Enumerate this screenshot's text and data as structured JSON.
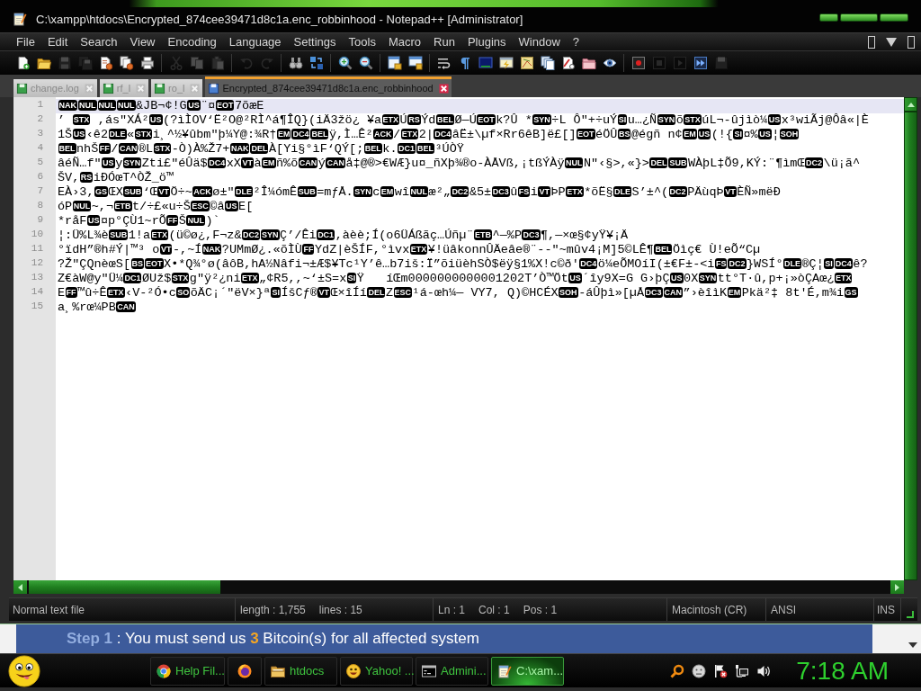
{
  "window": {
    "title": "C:\\xampp\\htdocs\\Encrypted_874cee39471d8c1a.enc_robbinhood - Notepad++ [Administrator]"
  },
  "menu": {
    "items": [
      "File",
      "Edit",
      "Search",
      "View",
      "Encoding",
      "Language",
      "Settings",
      "Tools",
      "Macro",
      "Run",
      "Plugins",
      "Window",
      "?"
    ]
  },
  "toolbar": {
    "groups": [
      {
        "items": [
          {
            "kind": "new",
            "disabled": false
          },
          {
            "kind": "open",
            "disabled": false
          },
          {
            "kind": "save",
            "disabled": true
          },
          {
            "kind": "saveall",
            "disabled": true
          },
          {
            "kind": "close",
            "disabled": false
          },
          {
            "kind": "closeall",
            "disabled": false
          },
          {
            "kind": "print",
            "disabled": false
          }
        ]
      },
      {
        "items": [
          {
            "kind": "cut",
            "disabled": true
          },
          {
            "kind": "copy",
            "disabled": true
          },
          {
            "kind": "paste",
            "disabled": true
          }
        ]
      },
      {
        "items": [
          {
            "kind": "undo",
            "disabled": true
          },
          {
            "kind": "redo",
            "disabled": true
          }
        ]
      },
      {
        "items": [
          {
            "kind": "find",
            "disabled": false
          },
          {
            "kind": "replace",
            "disabled": false
          }
        ]
      },
      {
        "items": [
          {
            "kind": "zoomin",
            "disabled": false
          },
          {
            "kind": "zoomout",
            "disabled": false
          }
        ]
      },
      {
        "items": [
          {
            "kind": "syncv",
            "disabled": false
          },
          {
            "kind": "synch",
            "disabled": false
          }
        ]
      },
      {
        "items": [
          {
            "kind": "wrap",
            "disabled": false
          },
          {
            "kind": "allchars",
            "disabled": false
          },
          {
            "kind": "indent",
            "disabled": false
          },
          {
            "kind": "udl",
            "disabled": false
          },
          {
            "kind": "docmap",
            "disabled": false
          },
          {
            "kind": "funclist",
            "disabled": false
          },
          {
            "kind": "autocomplete",
            "disabled": false
          },
          {
            "kind": "workspace",
            "disabled": false
          },
          {
            "kind": "monitor",
            "disabled": false
          }
        ]
      },
      {
        "items": [
          {
            "kind": "record",
            "disabled": false
          },
          {
            "kind": "stop",
            "disabled": true
          },
          {
            "kind": "play",
            "disabled": true
          },
          {
            "kind": "playmulti",
            "disabled": false
          },
          {
            "kind": "savemacro",
            "disabled": true
          }
        ]
      }
    ]
  },
  "tabs": [
    {
      "label": "change.log",
      "selected": false
    },
    {
      "label": "rf_l",
      "selected": false
    },
    {
      "label": "ro_l",
      "selected": false
    },
    {
      "label": "Encrypted_874cee39471d8c1a.enc_robbinhood",
      "selected": true
    }
  ],
  "editor": {
    "lines": [
      {
        "number": "1",
        "current": true,
        "segments": [
          {
            "kind": "ctrl",
            "text": "NAK"
          },
          {
            "kind": "ctrl",
            "text": "NUL"
          },
          {
            "kind": "ctrl",
            "text": "NUL"
          },
          {
            "kind": "ctrl",
            "text": "NUL"
          },
          {
            "kind": "text",
            "text": "&JB¬¢!G"
          },
          {
            "kind": "ctrl",
            "text": "US"
          },
          {
            "kind": "text",
            "text": "¨¤"
          },
          {
            "kind": "ctrl",
            "text": "EOT"
          },
          {
            "kind": "text",
            "text": "7õæE"
          }
        ]
      },
      {
        "number": "2",
        "current": false,
        "segments": [
          {
            "kind": "text",
            "text": "’ "
          },
          {
            "kind": "ctrl",
            "text": "STX"
          },
          {
            "kind": "text",
            "text": " ,ás\"XÁ²"
          },
          {
            "kind": "ctrl",
            "text": "US"
          },
          {
            "kind": "text",
            "text": "(?ìÌOV‘Ë²O@²RÌ^á¶ÎQ}(iÄ3žö¿ ¥a"
          },
          {
            "kind": "ctrl",
            "text": "ETX"
          },
          {
            "kind": "text",
            "text": "Ú"
          },
          {
            "kind": "ctrl",
            "text": "RS"
          },
          {
            "kind": "text",
            "text": "Ýd"
          },
          {
            "kind": "ctrl",
            "text": "BEL"
          },
          {
            "kind": "text",
            "text": "Ø—Ú"
          },
          {
            "kind": "ctrl",
            "text": "EOT"
          },
          {
            "kind": "text",
            "text": "k?Û *"
          },
          {
            "kind": "ctrl",
            "text": "SYN"
          },
          {
            "kind": "text",
            "text": "÷L Ô\"+÷uÝ"
          },
          {
            "kind": "ctrl",
            "text": "SI"
          },
          {
            "kind": "text",
            "text": "u…¿Ñ"
          },
          {
            "kind": "ctrl",
            "text": "SYN"
          },
          {
            "kind": "text",
            "text": "õ"
          },
          {
            "kind": "ctrl",
            "text": "STX"
          },
          {
            "kind": "text",
            "text": "úL¬-ûjìò¼"
          },
          {
            "kind": "ctrl",
            "text": "US"
          },
          {
            "kind": "text",
            "text": "x³wiÃj@Ôâ«|È"
          }
        ]
      },
      {
        "number": "3",
        "current": false,
        "segments": [
          {
            "kind": "text",
            "text": "1Š"
          },
          {
            "kind": "ctrl",
            "text": "US"
          },
          {
            "kind": "text",
            "text": "‹ê2"
          },
          {
            "kind": "ctrl",
            "text": "DLE"
          },
          {
            "kind": "text",
            "text": "«"
          },
          {
            "kind": "ctrl",
            "text": "STX"
          },
          {
            "kind": "text",
            "text": "i¸^½¥ûbm\"þ¼Y@:¾R†"
          },
          {
            "kind": "ctrl",
            "text": "EM"
          },
          {
            "kind": "ctrl",
            "text": "DC4"
          },
          {
            "kind": "ctrl",
            "text": "BEL"
          },
          {
            "kind": "text",
            "text": "ÿ,Ì…Ê²"
          },
          {
            "kind": "ctrl",
            "text": "ACK"
          },
          {
            "kind": "text",
            "text": "/"
          },
          {
            "kind": "ctrl",
            "text": "ETX"
          },
          {
            "kind": "text",
            "text": "2|"
          },
          {
            "kind": "ctrl",
            "text": "DC4"
          },
          {
            "kind": "text",
            "text": "âË±\\µf×Rr6êB]ë£[]"
          },
          {
            "kind": "ctrl",
            "text": "EOT"
          },
          {
            "kind": "text",
            "text": "éÖÛ"
          },
          {
            "kind": "ctrl",
            "text": "BS"
          },
          {
            "kind": "text",
            "text": "@égñ n¢"
          },
          {
            "kind": "ctrl",
            "text": "EM"
          },
          {
            "kind": "ctrl",
            "text": "US"
          },
          {
            "kind": "text",
            "text": "(!{"
          },
          {
            "kind": "ctrl",
            "text": "SI"
          },
          {
            "kind": "text",
            "text": "¤%"
          },
          {
            "kind": "ctrl",
            "text": "US"
          },
          {
            "kind": "text",
            "text": "¦"
          },
          {
            "kind": "ctrl",
            "text": "SOH"
          }
        ]
      },
      {
        "number": "4",
        "current": false,
        "segments": [
          {
            "kind": "ctrl",
            "text": "BEL"
          },
          {
            "kind": "text",
            "text": "nhŠ"
          },
          {
            "kind": "ctrl",
            "text": "FF"
          },
          {
            "kind": "text",
            "text": "/"
          },
          {
            "kind": "ctrl",
            "text": "CAN"
          },
          {
            "kind": "text",
            "text": "®L"
          },
          {
            "kind": "ctrl",
            "text": "STX"
          },
          {
            "kind": "text",
            "text": "-Ò)À%Ž7+"
          },
          {
            "kind": "ctrl",
            "text": "NAK"
          },
          {
            "kind": "ctrl",
            "text": "DEL"
          },
          {
            "kind": "text",
            "text": "À[Yi§°ìF‘QÝ[;"
          },
          {
            "kind": "ctrl",
            "text": "BEL"
          },
          {
            "kind": "text",
            "text": "k."
          },
          {
            "kind": "ctrl",
            "text": "DC1"
          },
          {
            "kind": "ctrl",
            "text": "BEL"
          },
          {
            "kind": "text",
            "text": "³ÚÒŸ"
          }
        ]
      },
      {
        "number": "5",
        "current": false,
        "segments": [
          {
            "kind": "text",
            "text": "âéÑ…f\""
          },
          {
            "kind": "ctrl",
            "text": "US"
          },
          {
            "kind": "text",
            "text": "y"
          },
          {
            "kind": "ctrl",
            "text": "SYN"
          },
          {
            "kind": "text",
            "text": "Zti£\"éÛä$"
          },
          {
            "kind": "ctrl",
            "text": "DC4"
          },
          {
            "kind": "text",
            "text": "xX"
          },
          {
            "kind": "ctrl",
            "text": "VT"
          },
          {
            "kind": "text",
            "text": "à"
          },
          {
            "kind": "ctrl",
            "text": "EM"
          },
          {
            "kind": "text",
            "text": "ñ%õ"
          },
          {
            "kind": "ctrl",
            "text": "CAN"
          },
          {
            "kind": "text",
            "text": "ý"
          },
          {
            "kind": "ctrl",
            "text": "CAN"
          },
          {
            "kind": "text",
            "text": "å‡@®>€WÆ}u¤_ñXþ¾®o-ÀÅVß,¡tßÝÀÿ"
          },
          {
            "kind": "ctrl",
            "text": "NUL"
          },
          {
            "kind": "text",
            "text": "N\"‹§>,«}>"
          },
          {
            "kind": "ctrl",
            "text": "DEL"
          },
          {
            "kind": "ctrl",
            "text": "SUB"
          },
          {
            "kind": "text",
            "text": "WÀþL‡Õ9,KÝ:¨¶ìmŒ"
          },
          {
            "kind": "ctrl",
            "text": "DC2"
          },
          {
            "kind": "text",
            "text": "\\ü¡ã^"
          }
        ]
      },
      {
        "number": "6",
        "current": false,
        "segments": [
          {
            "kind": "text",
            "text": "ŠV,"
          },
          {
            "kind": "ctrl",
            "text": "RS"
          },
          {
            "kind": "text",
            "text": "iÐÓœT^ÒŽ_ö™"
          }
        ]
      },
      {
        "number": "7",
        "current": false,
        "segments": [
          {
            "kind": "text",
            "text": "EÀ›3,"
          },
          {
            "kind": "ctrl",
            "text": "GS"
          },
          {
            "kind": "text",
            "text": "ŒX"
          },
          {
            "kind": "ctrl",
            "text": "SUB"
          },
          {
            "kind": "text",
            "text": "‘Œ"
          },
          {
            "kind": "ctrl",
            "text": "VT"
          },
          {
            "kind": "text",
            "text": "Ö÷~"
          },
          {
            "kind": "ctrl",
            "text": "ACK"
          },
          {
            "kind": "text",
            "text": "ø±\""
          },
          {
            "kind": "ctrl",
            "text": "DLE"
          },
          {
            "kind": "text",
            "text": "²Î¼ómÊ"
          },
          {
            "kind": "ctrl",
            "text": "SUB"
          },
          {
            "kind": "text",
            "text": "=mƒÅ."
          },
          {
            "kind": "ctrl",
            "text": "SYN"
          },
          {
            "kind": "text",
            "text": "c"
          },
          {
            "kind": "ctrl",
            "text": "EM"
          },
          {
            "kind": "text",
            "text": "wî"
          },
          {
            "kind": "ctrl",
            "text": "NUL"
          },
          {
            "kind": "text",
            "text": "æ²„"
          },
          {
            "kind": "ctrl",
            "text": "DC2"
          },
          {
            "kind": "text",
            "text": "&5±"
          },
          {
            "kind": "ctrl",
            "text": "DC3"
          },
          {
            "kind": "text",
            "text": "û"
          },
          {
            "kind": "ctrl",
            "text": "FS"
          },
          {
            "kind": "text",
            "text": "i"
          },
          {
            "kind": "ctrl",
            "text": "VT"
          },
          {
            "kind": "text",
            "text": "ÞP"
          },
          {
            "kind": "ctrl",
            "text": "ETX"
          },
          {
            "kind": "text",
            "text": "*õË§"
          },
          {
            "kind": "ctrl",
            "text": "DLE"
          },
          {
            "kind": "text",
            "text": "S’±^("
          },
          {
            "kind": "ctrl",
            "text": "DC2"
          },
          {
            "kind": "text",
            "text": "PÄùqÞ"
          },
          {
            "kind": "ctrl",
            "text": "VT"
          },
          {
            "kind": "text",
            "text": "ÈÑ»mëÐ"
          }
        ]
      },
      {
        "number": "8",
        "current": false,
        "segments": [
          {
            "kind": "text",
            "text": "óP"
          },
          {
            "kind": "ctrl",
            "text": "NUL"
          },
          {
            "kind": "text",
            "text": "~,¬"
          },
          {
            "kind": "ctrl",
            "text": "ETB"
          },
          {
            "kind": "text",
            "text": "t/÷£«u÷Š"
          },
          {
            "kind": "ctrl",
            "text": "ESC"
          },
          {
            "kind": "text",
            "text": "©â"
          },
          {
            "kind": "ctrl",
            "text": "US"
          },
          {
            "kind": "text",
            "text": "E["
          }
        ]
      },
      {
        "number": "9",
        "current": false,
        "segments": [
          {
            "kind": "text",
            "text": "*råF"
          },
          {
            "kind": "ctrl",
            "text": "US"
          },
          {
            "kind": "text",
            "text": "¤p°ÇÙ1~rÕ"
          },
          {
            "kind": "ctrl",
            "text": "FF"
          },
          {
            "kind": "text",
            "text": "Š"
          },
          {
            "kind": "ctrl",
            "text": "NUL"
          },
          {
            "kind": "text",
            "text": ")`"
          }
        ]
      },
      {
        "number": "10",
        "current": false,
        "segments": [
          {
            "kind": "text",
            "text": "¦:Ü%L¾è"
          },
          {
            "kind": "ctrl",
            "text": "SUB"
          },
          {
            "kind": "text",
            "text": "1!a"
          },
          {
            "kind": "ctrl",
            "text": "ETX"
          },
          {
            "kind": "text",
            "text": "(ü©ø¿,F¬z&"
          },
          {
            "kind": "ctrl",
            "text": "DC2"
          },
          {
            "kind": "ctrl",
            "text": "SYN"
          },
          {
            "kind": "text",
            "text": "Ç’/Êi"
          },
          {
            "kind": "ctrl",
            "text": "DC1"
          },
          {
            "kind": "text",
            "text": ",àèè;Í(o6ÜÁßãç…Úñµ¨"
          },
          {
            "kind": "ctrl",
            "text": "ETB"
          },
          {
            "kind": "text",
            "text": "^—%P"
          },
          {
            "kind": "ctrl",
            "text": "DC3"
          },
          {
            "kind": "text",
            "text": "¶,—×œ§¢yŸ¥¡Ä"
          }
        ]
      },
      {
        "number": "11",
        "current": false,
        "segments": [
          {
            "kind": "text",
            "text": "°ïdH”®h#Ý|™³ o"
          },
          {
            "kind": "ctrl",
            "text": "VT"
          },
          {
            "kind": "text",
            "text": "-,~Í"
          },
          {
            "kind": "ctrl",
            "text": "NAK"
          },
          {
            "kind": "text",
            "text": "?UMmØ¿.«õÌÙ"
          },
          {
            "kind": "ctrl",
            "text": "FF"
          },
          {
            "kind": "text",
            "text": "YdZ|èŠÍF,°ìvx"
          },
          {
            "kind": "ctrl",
            "text": "ETX"
          },
          {
            "kind": "text",
            "text": "¥!üâkonnÛÄeâe®¨--\"~mûv4¡M]5©LÊ¶"
          },
          {
            "kind": "ctrl",
            "text": "BEL"
          },
          {
            "kind": "text",
            "text": "Öìç€ Ù!eÕ“Cµ"
          }
        ]
      },
      {
        "number": "12",
        "current": false,
        "segments": [
          {
            "kind": "text",
            "text": "?Ž\"ÇQnèœS["
          },
          {
            "kind": "ctrl",
            "text": "BS"
          },
          {
            "kind": "ctrl",
            "text": "EOT"
          },
          {
            "kind": "text",
            "text": "X•*Q¾°ø(âôB,hA½Nâfi¬±Æ$¥Tc¹Y’ê…b7iš:Ï”õiüèhSÒ$ëÿ§1%X!c©ð'"
          },
          {
            "kind": "ctrl",
            "text": "DC4"
          },
          {
            "kind": "text",
            "text": "ö¼eÕMOíI(±€F±-<i"
          },
          {
            "kind": "ctrl",
            "text": "FS"
          },
          {
            "kind": "ctrl",
            "text": "DC2"
          },
          {
            "kind": "text",
            "text": "}WSÍ°"
          },
          {
            "kind": "ctrl",
            "text": "DLE"
          },
          {
            "kind": "text",
            "text": "®Ç¦"
          },
          {
            "kind": "ctrl",
            "text": "SI"
          },
          {
            "kind": "ctrl",
            "text": "DC4"
          },
          {
            "kind": "text",
            "text": "ê?"
          }
        ]
      },
      {
        "number": "13",
        "current": false,
        "segments": [
          {
            "kind": "text",
            "text": "Z€àW@y\"Ü¼"
          },
          {
            "kind": "ctrl",
            "text": "DC1"
          },
          {
            "kind": "text",
            "text": "ØUž$"
          },
          {
            "kind": "ctrl",
            "text": "STX"
          },
          {
            "kind": "text",
            "text": "g\"ÿ²¿ni"
          },
          {
            "kind": "ctrl",
            "text": "ETX"
          },
          {
            "kind": "text",
            "text": "„¢R5,,~‘±S=x"
          },
          {
            "kind": "ctrl",
            "text": "SI"
          },
          {
            "kind": "text",
            "text": "Ÿ   íŒm0000000000001202T’Ò™Öt"
          },
          {
            "kind": "ctrl",
            "text": "US"
          },
          {
            "kind": "text",
            "text": "´îy9X=G G›þÇ"
          },
          {
            "kind": "ctrl",
            "text": "US"
          },
          {
            "kind": "text",
            "text": "0X"
          },
          {
            "kind": "ctrl",
            "text": "SYN"
          },
          {
            "kind": "text",
            "text": "tt°T·û,p+¡»òÇAœ¿"
          },
          {
            "kind": "ctrl",
            "text": "ETX"
          }
        ]
      },
      {
        "number": "14",
        "current": false,
        "segments": [
          {
            "kind": "text",
            "text": "E"
          },
          {
            "kind": "ctrl",
            "text": "FF"
          },
          {
            "kind": "text",
            "text": "™û÷Ê"
          },
          {
            "kind": "ctrl",
            "text": "ETX"
          },
          {
            "kind": "text",
            "text": "‹V-²Ó•c"
          },
          {
            "kind": "ctrl",
            "text": "SO"
          },
          {
            "kind": "text",
            "text": "õÄC¡´\"ëV×}ª"
          },
          {
            "kind": "ctrl",
            "text": "SI"
          },
          {
            "kind": "text",
            "text": "ÍšCƒ®"
          },
          {
            "kind": "ctrl",
            "text": "VT"
          },
          {
            "kind": "text",
            "text": "Œ×îÍí"
          },
          {
            "kind": "ctrl",
            "text": "DEL"
          },
          {
            "kind": "text",
            "text": "Z"
          },
          {
            "kind": "ctrl",
            "text": "ESC"
          },
          {
            "kind": "text",
            "text": "¹á-œh¼— VY7, Q)©HCÉX"
          },
          {
            "kind": "ctrl",
            "text": "SOH"
          },
          {
            "kind": "text",
            "text": "-áÛþì»[µÅ"
          },
          {
            "kind": "ctrl",
            "text": "DC3"
          },
          {
            "kind": "ctrl",
            "text": "CAN"
          },
          {
            "kind": "text",
            "text": "”›èîìK"
          },
          {
            "kind": "ctrl",
            "text": "EM"
          },
          {
            "kind": "text",
            "text": "Pkä²‡ 8t'É,m¾i"
          },
          {
            "kind": "ctrl",
            "text": "GS"
          }
        ]
      },
      {
        "number": "15",
        "current": false,
        "segments": [
          {
            "kind": "text",
            "text": "a¸%rœ¼PB"
          },
          {
            "kind": "ctrl",
            "text": "CAN"
          }
        ]
      }
    ]
  },
  "status_bar": {
    "file_type": "Normal text file",
    "length": "length : 1,755",
    "lines": "lines : 15",
    "line": "Ln : 1",
    "column": "Col : 1",
    "position": "Pos : 1",
    "line_ending": "Macintosh (CR)",
    "encoding": "ANSI",
    "mode": "INS"
  },
  "background_page": {
    "banner": [
      {
        "kind": "label",
        "text": "Step 1"
      },
      {
        "kind": "plain",
        "text": " : You must send us "
      },
      {
        "kind": "highlight",
        "text": "3"
      },
      {
        "kind": "plain",
        "text": " Bitcoin(s) for all affected system"
      }
    ]
  },
  "taskbar": {
    "buttons": [
      {
        "kind": "ring",
        "label": "Help Fil...",
        "selected": false
      },
      {
        "kind": "fireball",
        "selected": false
      },
      {
        "kind": "folder",
        "label": "htdocs",
        "selected": false
      },
      {
        "kind": "smiley",
        "label": "Yahoo! ...",
        "selected": false
      },
      {
        "kind": "console",
        "label": "Admini...",
        "selected": false
      },
      {
        "kind": "notepad",
        "label": "C:\\xam...",
        "selected": true
      }
    ],
    "clock": "7:18 AM"
  }
}
